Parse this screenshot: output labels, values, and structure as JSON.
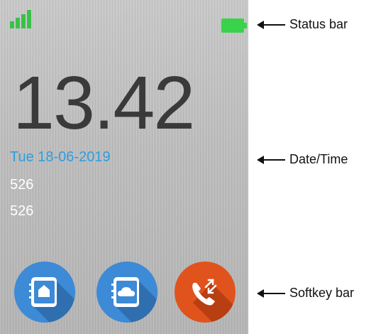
{
  "screen": {
    "time": "13.42",
    "date": "Tue 18-06-2019",
    "line1": "526",
    "line2": "526"
  },
  "status": {
    "signal_icon": "signal-bars-icon",
    "battery_icon": "battery-full-icon"
  },
  "softkeys": [
    {
      "icon": "home-contacts-icon"
    },
    {
      "icon": "cloud-contacts-icon"
    },
    {
      "icon": "call-transfer-icon"
    }
  ],
  "annotations": {
    "status_bar": "Status bar",
    "date_time": "Date/Time",
    "softkey_bar": "Softkey bar"
  },
  "colors": {
    "accent_blue": "#2b9fe0",
    "softkey_blue": "#3d8ad6",
    "softkey_orange": "#e0531d",
    "battery_green": "#39d24a"
  }
}
